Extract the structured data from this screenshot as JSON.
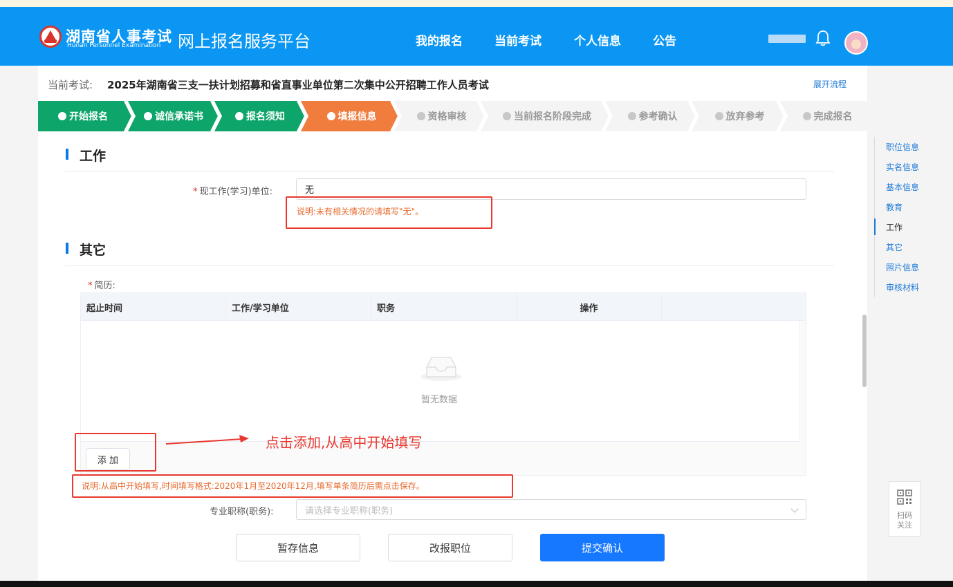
{
  "header": {
    "logo_cn": "湖南省人事考试",
    "logo_en": "Hunan Personnel Examination",
    "platform": "网上报名服务平台",
    "nav": [
      "我的报名",
      "当前考试",
      "个人信息",
      "公告"
    ],
    "icons": [
      "bell-icon",
      "avatar"
    ],
    "accent_color": "#0a96f2"
  },
  "exam": {
    "label": "当前考试:",
    "title": "2025年湖南省三支一扶计划招募和省直事业单位第二次集中公开招聘工作人员考试",
    "expand_link": "展开流程"
  },
  "steps": [
    {
      "label": "开始报名",
      "state": "done"
    },
    {
      "label": "诚信承诺书",
      "state": "done"
    },
    {
      "label": "报名须知",
      "state": "done"
    },
    {
      "label": "填报信息",
      "state": "active"
    },
    {
      "label": "资格审核",
      "state": "todo"
    },
    {
      "label": "当前报名阶段完成",
      "state": "todo"
    },
    {
      "label": "参考确认",
      "state": "todo"
    },
    {
      "label": "放弃参考",
      "state": "todo"
    },
    {
      "label": "完成报名",
      "state": "todo"
    }
  ],
  "work": {
    "title": "工作",
    "required_mark": "*",
    "field_label": "现工作(学习)单位:",
    "field_value": "无",
    "hint": "说明:未有相关情况的请填写\"无\"。"
  },
  "other": {
    "title": "其它",
    "required_mark": "*",
    "resume_label": "简历:",
    "table_headers": [
      "起止时间",
      "工作/学习单位",
      "职务",
      "操作"
    ],
    "empty_text": "暂无数据",
    "add_button": "添 加",
    "annotation": "点击添加,从高中开始填写",
    "hint": "说明:从高中开始填写,时间填写格式:2020年1月至2020年12月,填写单条简历后需点击保存。",
    "title_label": "专业职称(职务):",
    "title_placeholder": "请选择专业职称(职务)"
  },
  "actions": {
    "save": "暂存信息",
    "change": "改报职位",
    "submit": "提交确认"
  },
  "side_nav": {
    "items": [
      "职位信息",
      "实名信息",
      "基本信息",
      "教育",
      "工作",
      "其它",
      "照片信息",
      "审核材料"
    ],
    "active": "工作"
  },
  "qr": {
    "line1": "扫码",
    "line2": "关注"
  }
}
